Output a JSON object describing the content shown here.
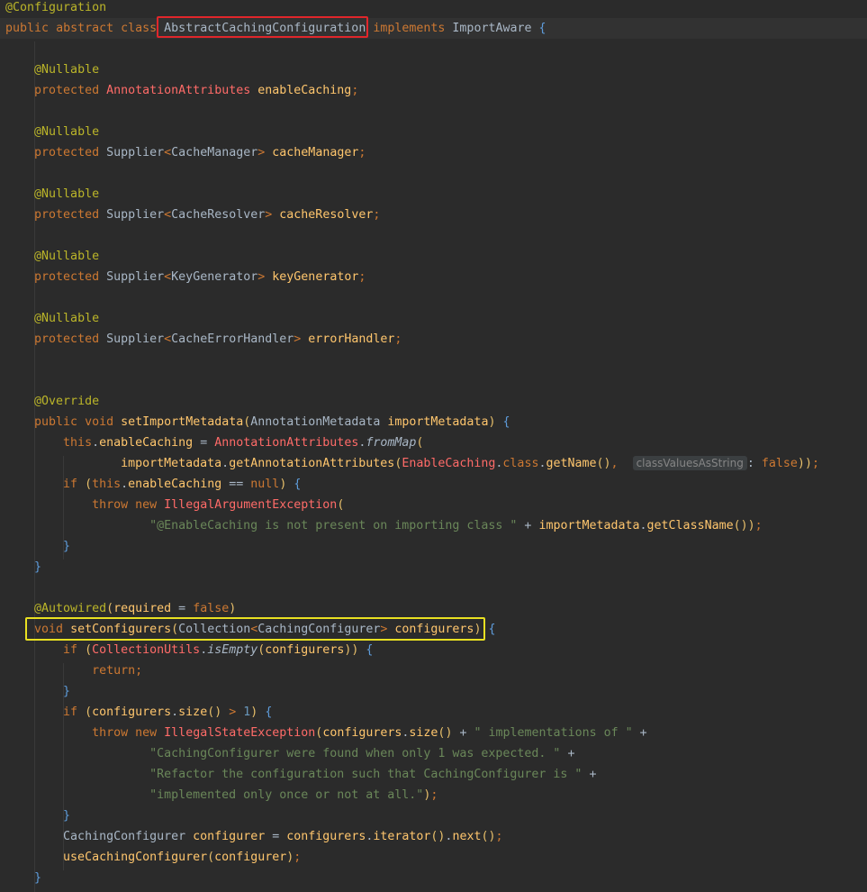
{
  "editor": {
    "lines": [
      {
        "text": "@Configuration"
      },
      {
        "text": "public abstract class AbstractCachingConfiguration implements ImportAware {"
      },
      {
        "text": ""
      },
      {
        "text": "    @Nullable"
      },
      {
        "text": "    protected AnnotationAttributes enableCaching;"
      },
      {
        "text": ""
      },
      {
        "text": "    @Nullable"
      },
      {
        "text": "    protected Supplier<CacheManager> cacheManager;"
      },
      {
        "text": ""
      },
      {
        "text": "    @Nullable"
      },
      {
        "text": "    protected Supplier<CacheResolver> cacheResolver;"
      },
      {
        "text": ""
      },
      {
        "text": "    @Nullable"
      },
      {
        "text": "    protected Supplier<KeyGenerator> keyGenerator;"
      },
      {
        "text": ""
      },
      {
        "text": "    @Nullable"
      },
      {
        "text": "    protected Supplier<CacheErrorHandler> errorHandler;"
      },
      {
        "text": ""
      },
      {
        "text": ""
      },
      {
        "text": "    @Override"
      },
      {
        "text": "    public void setImportMetadata(AnnotationMetadata importMetadata) {"
      },
      {
        "text": "        this.enableCaching = AnnotationAttributes.fromMap("
      },
      {
        "text": "                importMetadata.getAnnotationAttributes(EnableCaching.class.getName(),  classValuesAsString: false));"
      },
      {
        "text": "        if (this.enableCaching == null) {"
      },
      {
        "text": "            throw new IllegalArgumentException("
      },
      {
        "text": "                    \"@EnableCaching is not present on importing class \" + importMetadata.getClassName());"
      },
      {
        "text": "        }"
      },
      {
        "text": "    }"
      },
      {
        "text": ""
      },
      {
        "text": "    @Autowired(required = false)"
      },
      {
        "text": "    void setConfigurers(Collection<CachingConfigurer> configurers) {"
      },
      {
        "text": "        if (CollectionUtils.isEmpty(configurers)) {"
      },
      {
        "text": "            return;"
      },
      {
        "text": "        }"
      },
      {
        "text": "        if (configurers.size() > 1) {"
      },
      {
        "text": "            throw new IllegalStateException(configurers.size() + \" implementations of \" +"
      },
      {
        "text": "                    \"CachingConfigurer were found when only 1 was expected. \" +"
      },
      {
        "text": "                    \"Refactor the configuration such that CachingConfigurer is \" +"
      },
      {
        "text": "                    \"implemented only once or not at all.\");"
      },
      {
        "text": "        }"
      },
      {
        "text": "        CachingConfigurer configurer = configurers.iterator().next();"
      },
      {
        "text": "        useCachingConfigurer(configurer);"
      },
      {
        "text": "    }"
      }
    ]
  },
  "highlights": {
    "class_name": "AbstractCachingConfiguration",
    "method_signature": "void setConfigurers(Collection<CachingConfigurer> configurers)"
  },
  "colors": {
    "background": "#2b2b2b",
    "keyword": "#cc7832",
    "annotation": "#bbb529",
    "string": "#6a8759",
    "number": "#6897bb",
    "method": "#ffc66d",
    "field": "#9876aa",
    "red_box": "#e0262b",
    "yellow_box": "#e8e021"
  }
}
